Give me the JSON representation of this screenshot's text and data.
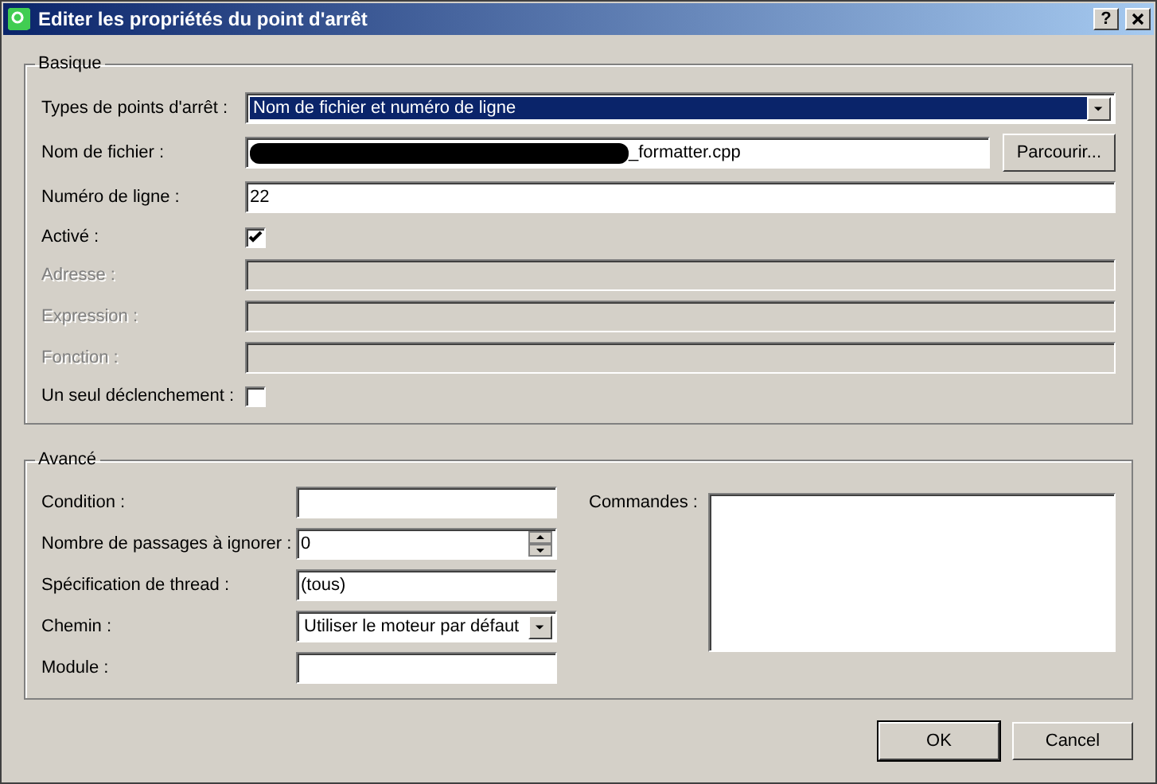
{
  "window": {
    "title": "Editer les propriétés du point d'arrêt",
    "help": "?"
  },
  "basic": {
    "title": "Basique",
    "fields": [
      {
        "kind": "combo",
        "label": "Types de points d'arrêt :",
        "value": "Nom de fichier et numéro de ligne",
        "selected": true,
        "disabled": false
      },
      {
        "kind": "file",
        "label": "Nom de fichier :",
        "value": "_formatter.cpp",
        "button": "Parcourir...",
        "disabled": false
      },
      {
        "kind": "text",
        "label": "Numéro de ligne :",
        "value": "22",
        "disabled": false
      },
      {
        "kind": "checkbox",
        "label": "Activé :",
        "checked": true,
        "disabled": false
      },
      {
        "kind": "text",
        "label": "Adresse :",
        "disabled": true
      },
      {
        "kind": "text",
        "label": "Expression :",
        "disabled": true
      },
      {
        "kind": "text",
        "label": "Fonction :",
        "disabled": true
      },
      {
        "kind": "checkbox",
        "label": "Un seul déclenchement :",
        "checked": false,
        "disabled": false
      }
    ]
  },
  "advanced": {
    "title": "Avancé",
    "fields": [
      {
        "kind": "text",
        "label": "Condition :"
      },
      {
        "kind": "spin",
        "label": "Nombre de passages à ignorer :",
        "value": "0"
      },
      {
        "kind": "text",
        "label": "Spécification de thread :",
        "value": "(tous)"
      },
      {
        "kind": "combo",
        "label": "Chemin :",
        "value": "Utiliser le moteur par défaut",
        "selected": false
      },
      {
        "kind": "text",
        "label": "Module :"
      }
    ],
    "commands": {
      "label": "Commandes :"
    }
  },
  "buttons": [
    {
      "label": "OK",
      "default": true
    },
    {
      "label": "Cancel",
      "default": false
    }
  ]
}
